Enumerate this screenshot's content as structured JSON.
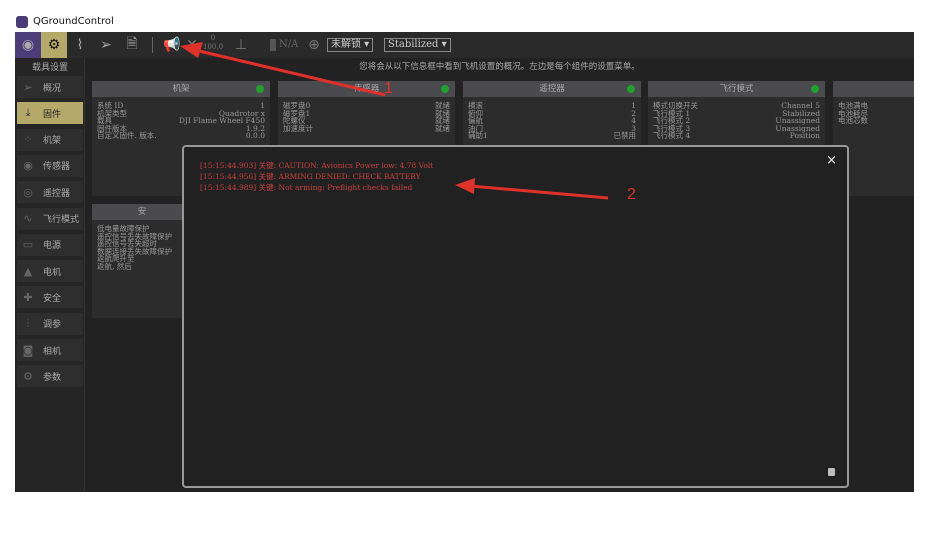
{
  "app": {
    "title": "QGroundControl"
  },
  "toolbar": {
    "battery": "N/A",
    "msg_count": "0",
    "msg_pct": "100.0",
    "arm_state": "未解锁",
    "flight_mode": "Stabilized"
  },
  "sidebar": {
    "title": "载具设置",
    "items": [
      {
        "label": "概况",
        "icon": "paper-plane-icon"
      },
      {
        "label": "固件",
        "icon": "download-icon",
        "selected": true
      },
      {
        "label": "机架",
        "icon": "airframe-icon"
      },
      {
        "label": "传感器",
        "icon": "sensor-icon"
      },
      {
        "label": "遥控器",
        "icon": "radio-icon"
      },
      {
        "label": "飞行模式",
        "icon": "flight-mode-icon"
      },
      {
        "label": "电源",
        "icon": "battery-icon"
      },
      {
        "label": "电机",
        "icon": "motor-icon"
      },
      {
        "label": "安全",
        "icon": "medkit-icon"
      },
      {
        "label": "调参",
        "icon": "sliders-icon"
      },
      {
        "label": "相机",
        "icon": "camera-icon"
      },
      {
        "label": "参数",
        "icon": "gears-icon"
      }
    ]
  },
  "main": {
    "hint": "您将会从以下信息框中看到飞机设置的概况。左边是每个组件的设置菜单。",
    "cards": [
      {
        "title": "机架",
        "rows": [
          [
            "系统 ID",
            "1"
          ],
          [
            "机架类型",
            "Quadrotor x"
          ],
          [
            "载具",
            "DJI Flame Wheel F450"
          ],
          [
            "固件版本",
            "1.9.2"
          ],
          [
            "自定义固件. 版本.",
            "0.0.0"
          ]
        ]
      },
      {
        "title": "传感器",
        "rows": [
          [
            "磁罗盘0",
            "就绪"
          ],
          [
            "磁罗盘1",
            "就绪"
          ],
          [
            "陀螺仪",
            "就绪"
          ],
          [
            "加速度计",
            "就绪"
          ]
        ]
      },
      {
        "title": "遥控器",
        "rows": [
          [
            "横滚",
            "1"
          ],
          [
            "俯仰",
            "2"
          ],
          [
            "偏航",
            "4"
          ],
          [
            "油门",
            "3"
          ],
          [
            "辅助1",
            "已禁用"
          ]
        ]
      },
      {
        "title": "飞行模式",
        "rows": [
          [
            "模式切换开关",
            "Channel 5"
          ],
          [
            "飞行模式 1",
            "Stabilized"
          ],
          [
            "飞行模式 2",
            "Unassigned"
          ],
          [
            "飞行模式 3",
            "Unassigned"
          ],
          [
            "飞行模式 4",
            "Position"
          ]
        ]
      },
      {
        "title": "",
        "rows": [
          [
            "电池满电",
            ""
          ],
          [
            "电池耗尽",
            ""
          ],
          [
            "电池芯数",
            ""
          ]
        ]
      }
    ],
    "safety": {
      "title": "安",
      "rows": [
        "低电量故障保护",
        "遥控信号丢失故障保护",
        "遥控信号丢失超时",
        "数据连接丢失故障保护",
        "返航爬升至",
        "返航, 然后"
      ]
    }
  },
  "dialog": {
    "close": "×",
    "messages": [
      "[15:15:44.903] 关键:  CAUTION: Avionics Power low: 4.78 Volt",
      "[15:15:44.956] 关键:  ARMING DENIED: CHECK BATTERY",
      "[15:15:44.989] 关键:  Not arming: Preflight checks failed"
    ]
  },
  "annotations": {
    "a1": "1",
    "a2": "2"
  }
}
